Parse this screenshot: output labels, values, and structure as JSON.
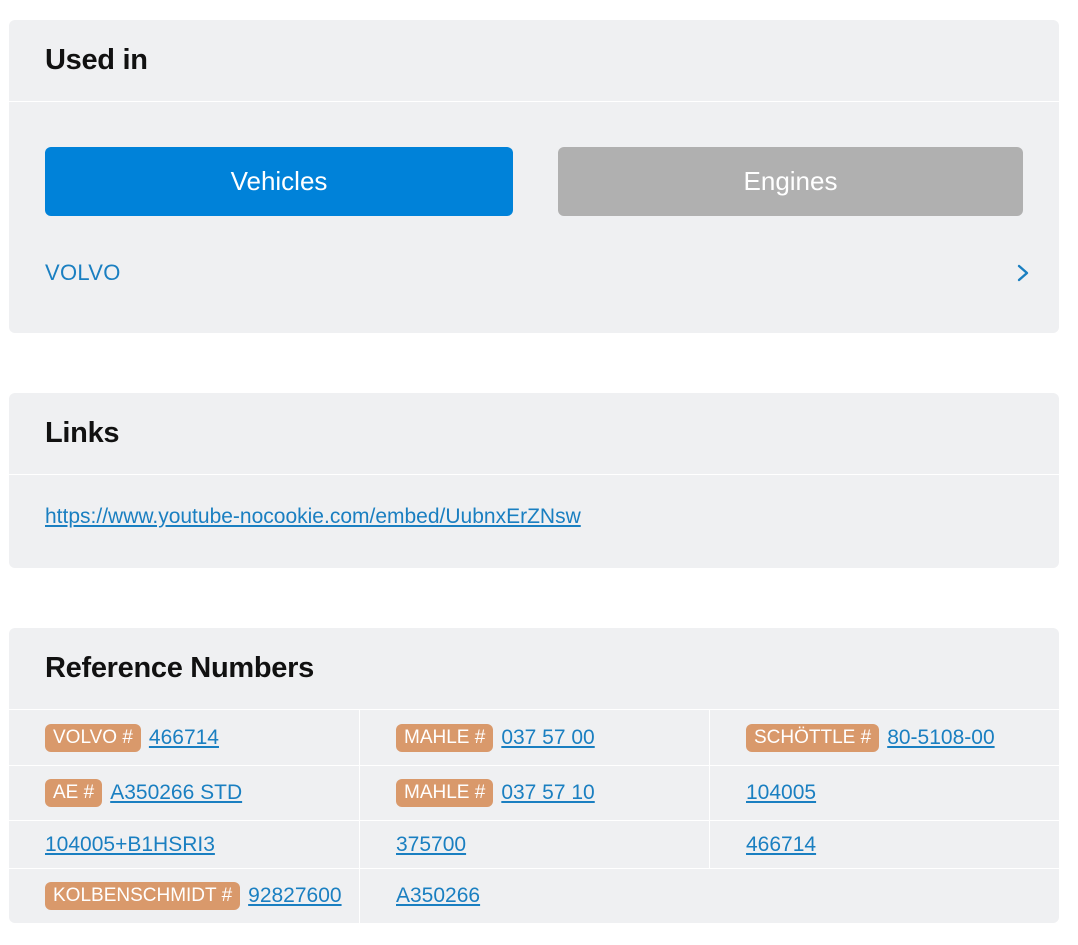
{
  "used_in": {
    "title": "Used in",
    "tabs": [
      {
        "label": "Vehicles",
        "active": true
      },
      {
        "label": "Engines",
        "active": false
      }
    ],
    "makes": [
      {
        "label": "VOLVO"
      }
    ]
  },
  "links": {
    "title": "Links",
    "items": [
      {
        "url": "https://www.youtube-nocookie.com/embed/UubnxErZNsw"
      }
    ]
  },
  "reference_numbers": {
    "title": "Reference Numbers",
    "rows": [
      [
        {
          "brand": "VOLVO #",
          "number": "466714"
        },
        {
          "brand": "MAHLE #",
          "number": "037 57 00"
        },
        {
          "brand": "SCHÖTTLE #",
          "number": "80-5108-00"
        }
      ],
      [
        {
          "brand": "AE #",
          "number": "A350266 STD"
        },
        {
          "brand": "MAHLE #",
          "number": "037 57 10"
        },
        {
          "brand": "",
          "number": "104005"
        }
      ],
      [
        {
          "brand": "",
          "number": "104005+B1HSRI3"
        },
        {
          "brand": "",
          "number": "375700"
        },
        {
          "brand": "",
          "number": "466714"
        }
      ],
      [
        {
          "brand": "KOLBENSCHMIDT #",
          "number": "92827600"
        },
        {
          "brand": "",
          "number": "A350266"
        }
      ]
    ]
  },
  "colors": {
    "accent": "#0082d9",
    "inactive_tab": "#b0b0b0",
    "link": "#1a7fc1",
    "badge": "#d9996b",
    "card_bg": "#eff0f2"
  }
}
